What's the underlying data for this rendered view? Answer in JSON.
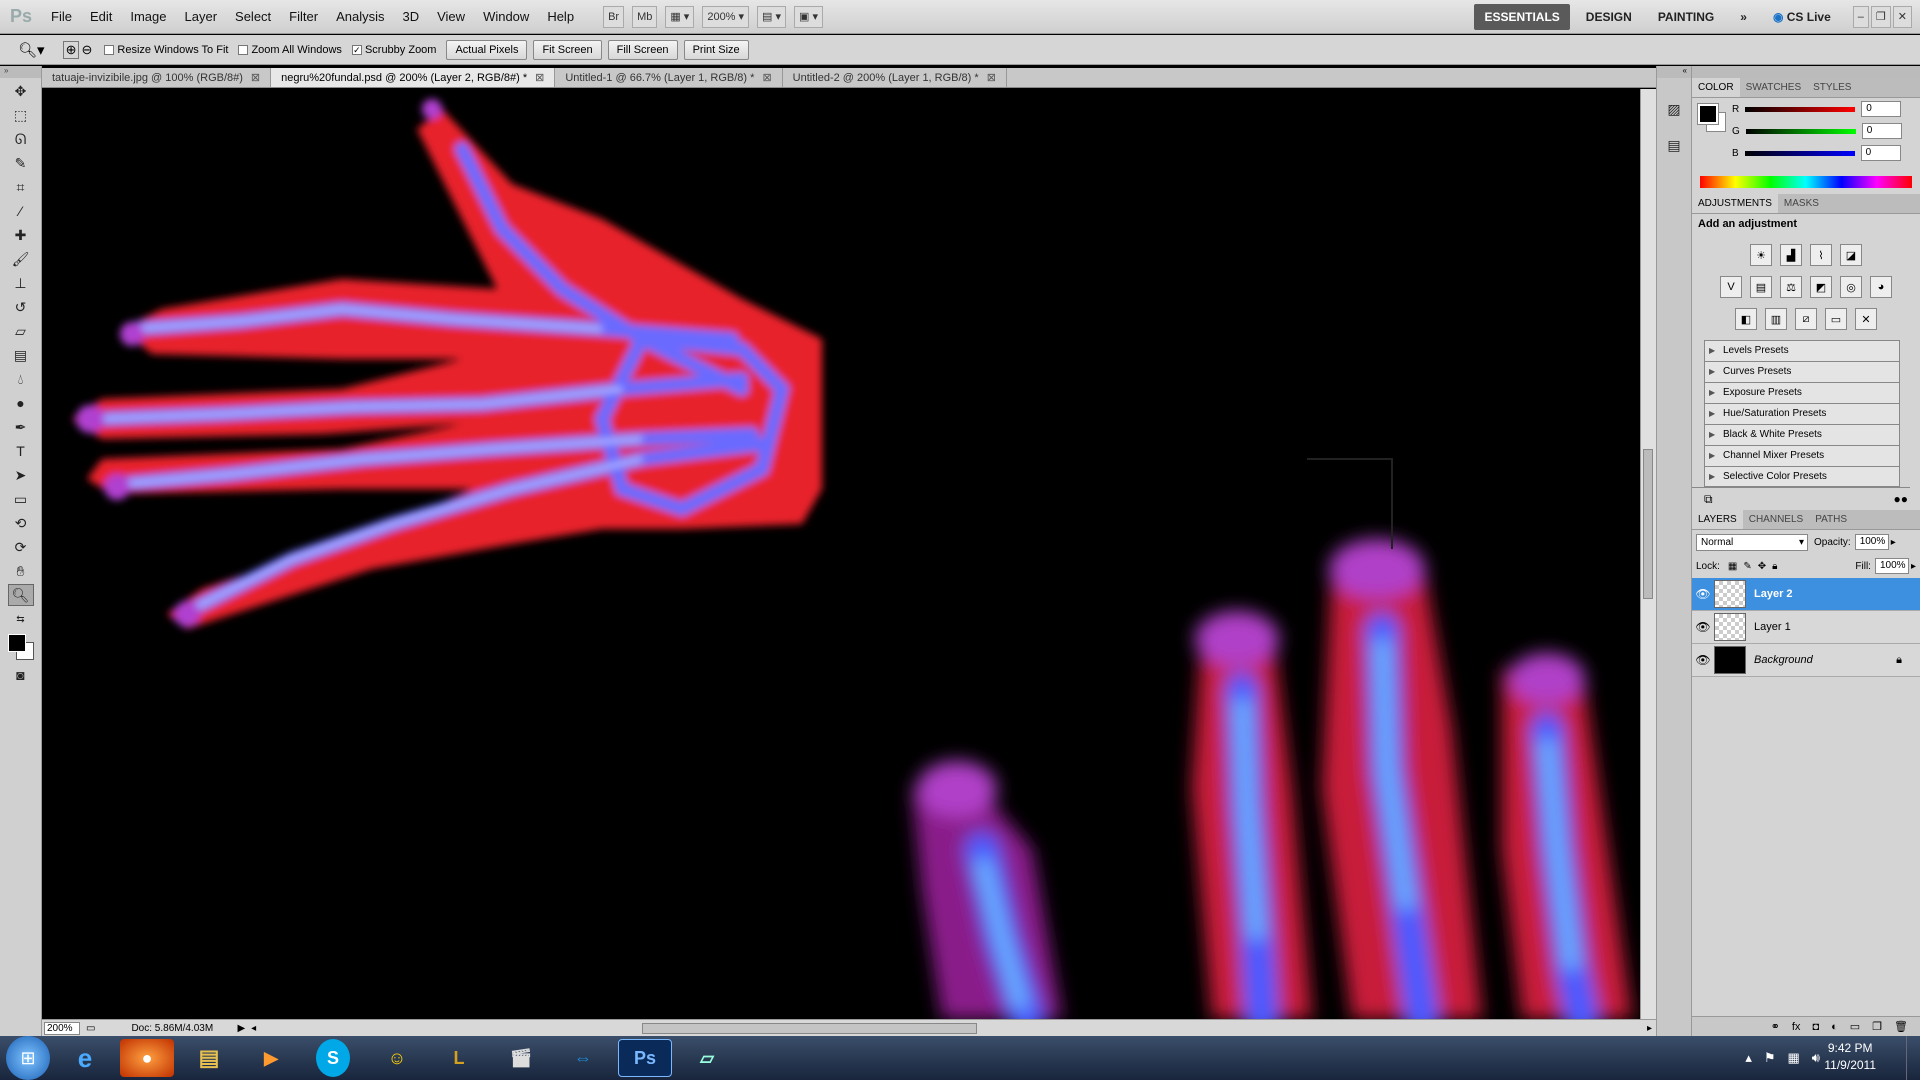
{
  "app": {
    "logo": "Ps"
  },
  "menu": [
    "File",
    "Edit",
    "Image",
    "Layer",
    "Select",
    "Filter",
    "Analysis",
    "3D",
    "View",
    "Window",
    "Help"
  ],
  "menubar": {
    "br": "Br",
    "mb": "Mb",
    "zoom": "200%",
    "workspaces": [
      "ESSENTIALS",
      "DESIGN",
      "PAINTING"
    ],
    "more": "»",
    "cslive": "CS Live"
  },
  "options": {
    "resize_windows": "Resize Windows To Fit",
    "zoom_all": "Zoom All Windows",
    "scrubby": "Scrubby Zoom",
    "actual_pixels": "Actual Pixels",
    "fit_screen": "Fit Screen",
    "fill_screen": "Fill Screen",
    "print_size": "Print Size"
  },
  "tabs": [
    {
      "label": "tatuaje-invizibile.jpg @ 100% (RGB/8#)",
      "active": false
    },
    {
      "label": "negru%20fundal.psd @ 200% (Layer 2, RGB/8#) *",
      "active": true
    },
    {
      "label": "Untitled-1 @ 66.7% (Layer 1, RGB/8) *",
      "active": false
    },
    {
      "label": "Untitled-2 @ 200% (Layer 1, RGB/8) *",
      "active": false
    }
  ],
  "status": {
    "zoom": "200%",
    "doc": "Doc: 5.86M/4.03M"
  },
  "color_panel": {
    "tabs": [
      "COLOR",
      "SWATCHES",
      "STYLES"
    ],
    "r_label": "R",
    "g_label": "G",
    "b_label": "B",
    "r": "0",
    "g": "0",
    "b": "0"
  },
  "adjustments": {
    "tabs": [
      "ADJUSTMENTS",
      "MASKS"
    ],
    "heading": "Add an adjustment",
    "presets": [
      "Levels Presets",
      "Curves Presets",
      "Exposure Presets",
      "Hue/Saturation Presets",
      "Black & White Presets",
      "Channel Mixer Presets",
      "Selective Color Presets"
    ]
  },
  "layers_panel": {
    "tabs": [
      "LAYERS",
      "CHANNELS",
      "PATHS"
    ],
    "blend": "Normal",
    "opacity_label": "Opacity:",
    "opacity": "100%",
    "lock_label": "Lock:",
    "fill_label": "Fill:",
    "fill": "100%",
    "layers": [
      {
        "name": "Layer 2",
        "selected": true
      },
      {
        "name": "Layer 1",
        "selected": false
      },
      {
        "name": "Background",
        "selected": false
      }
    ]
  },
  "clock": {
    "time": "9:42 PM",
    "date": "11/9/2011"
  }
}
